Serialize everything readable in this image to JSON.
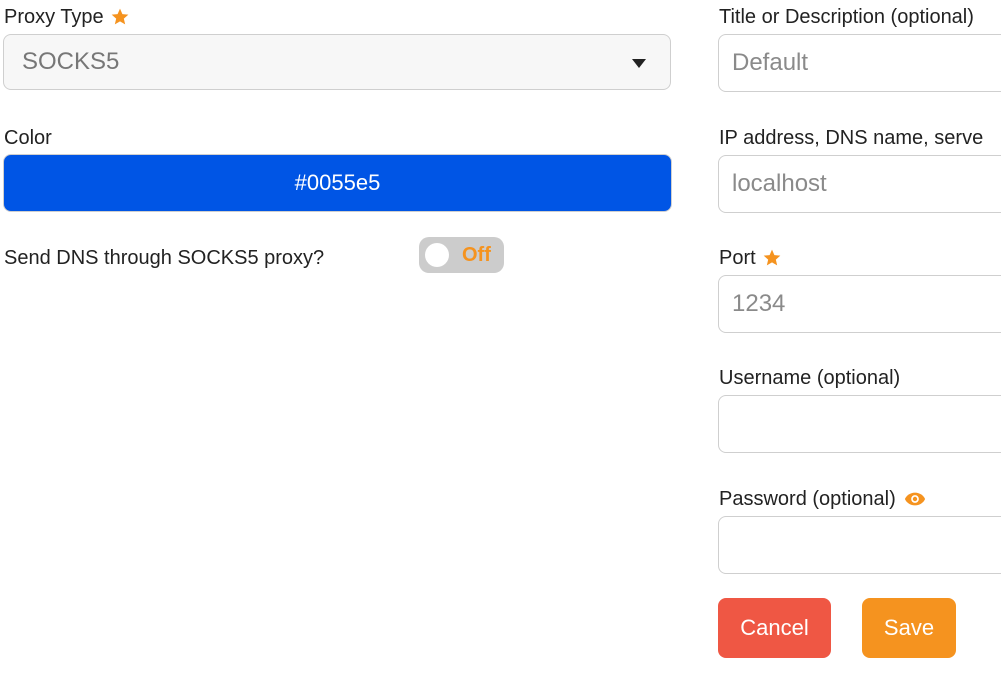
{
  "colors": {
    "accent_orange": "#f5931f",
    "selected_color": "#0055e5",
    "cancel_red": "#ef5744",
    "toggle_off_bg": "#cccccc"
  },
  "proxy_type": {
    "label": "Proxy Type",
    "value": "SOCKS5"
  },
  "color_field": {
    "label": "Color",
    "value": "#0055e5"
  },
  "dns_toggle": {
    "label": "Send DNS through SOCKS5 proxy?",
    "state": "Off"
  },
  "title_field": {
    "label": "Title or Description (optional)",
    "placeholder": "Default"
  },
  "address_field": {
    "label": "IP address, DNS name, serve",
    "placeholder": "localhost"
  },
  "port_field": {
    "label": "Port",
    "placeholder": "1234"
  },
  "username_field": {
    "label": "Username (optional)",
    "value": ""
  },
  "password_field": {
    "label": "Password (optional)",
    "value": ""
  },
  "buttons": {
    "cancel": "Cancel",
    "save": "Save"
  }
}
